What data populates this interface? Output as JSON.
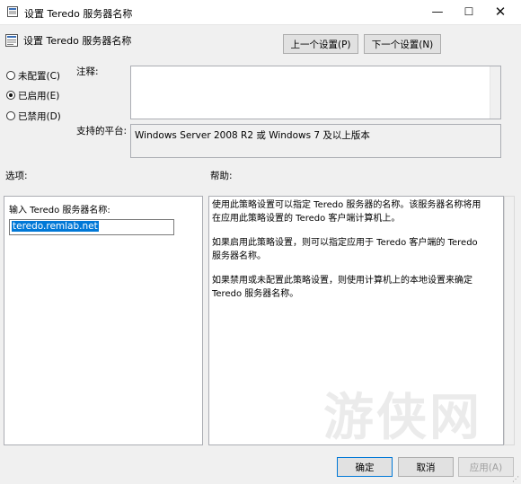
{
  "window": {
    "title": "设置 Teredo 服务器名称",
    "minimize": "—",
    "maximize": "☐",
    "close": "✕"
  },
  "header": {
    "title": "设置 Teredo 服务器名称",
    "prev_label": "上一个设置(P)",
    "next_label": "下一个设置(N)"
  },
  "state": {
    "options": [
      {
        "label": "未配置(C)",
        "checked": false
      },
      {
        "label": "已启用(E)",
        "checked": true
      },
      {
        "label": "已禁用(D)",
        "checked": false
      }
    ]
  },
  "comment": {
    "label": "注释:",
    "value": ""
  },
  "platform": {
    "label": "支持的平台:",
    "value": "Windows Server 2008 R2 或 Windows 7 及以上版本"
  },
  "options_pane": {
    "section_label": "选项:",
    "field_label": "输入 Teredo 服务器名称:",
    "field_value": "teredo.remlab.net"
  },
  "help_pane": {
    "section_label": "帮助:",
    "paragraphs": [
      "使用此策略设置可以指定 Teredo 服务器的名称。该服务器名称将用在应用此策略设置的 Teredo 客户端计算机上。",
      "如果启用此策略设置，则可以指定应用于 Teredo 客户端的 Teredo 服务器名称。",
      "如果禁用或未配置此策略设置，则使用计算机上的本地设置来确定 Teredo 服务器名称。"
    ]
  },
  "footer": {
    "ok_label": "确定",
    "cancel_label": "取消",
    "apply_label": "应用(A)"
  },
  "watermark": "游侠网",
  "colors": {
    "accent": "#0078d7",
    "background": "#f0f0f0"
  }
}
